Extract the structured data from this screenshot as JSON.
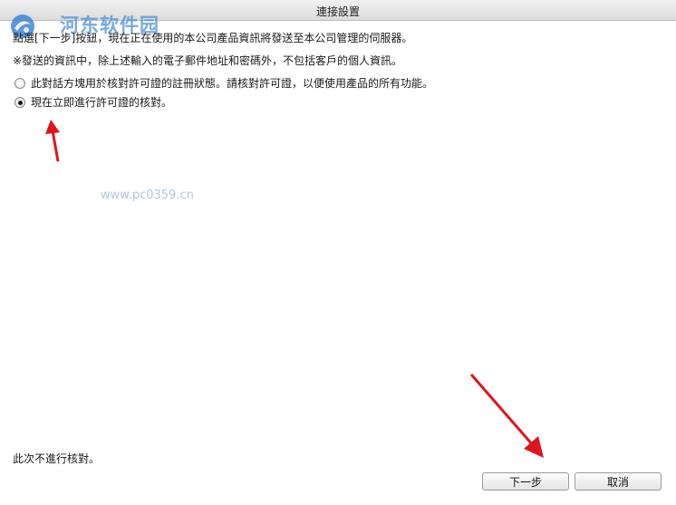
{
  "window": {
    "title": "連接設置"
  },
  "watermark": {
    "brand": "河东软件园",
    "url": "www.pc0359.cn"
  },
  "content": {
    "intro": "點選[下一步]按鈕，現在正在使用的本公司產品資訊將發送至本公司管理的伺服器。",
    "note": "※發送的資訊中，除上述輸入的電子郵件地址和密碼外，不包括客戶的個人資訊。",
    "options": [
      {
        "label": "此對話方塊用於核對許可證的註冊狀態。請核對許可證，以便使用產品的所有功能。",
        "selected": false
      },
      {
        "label": "現在立即進行許可證的核對。",
        "selected": true
      }
    ],
    "footer_note": "此次不進行核對。"
  },
  "buttons": {
    "next": "下一步",
    "cancel": "取消"
  },
  "annotation_color": "#e0151b"
}
